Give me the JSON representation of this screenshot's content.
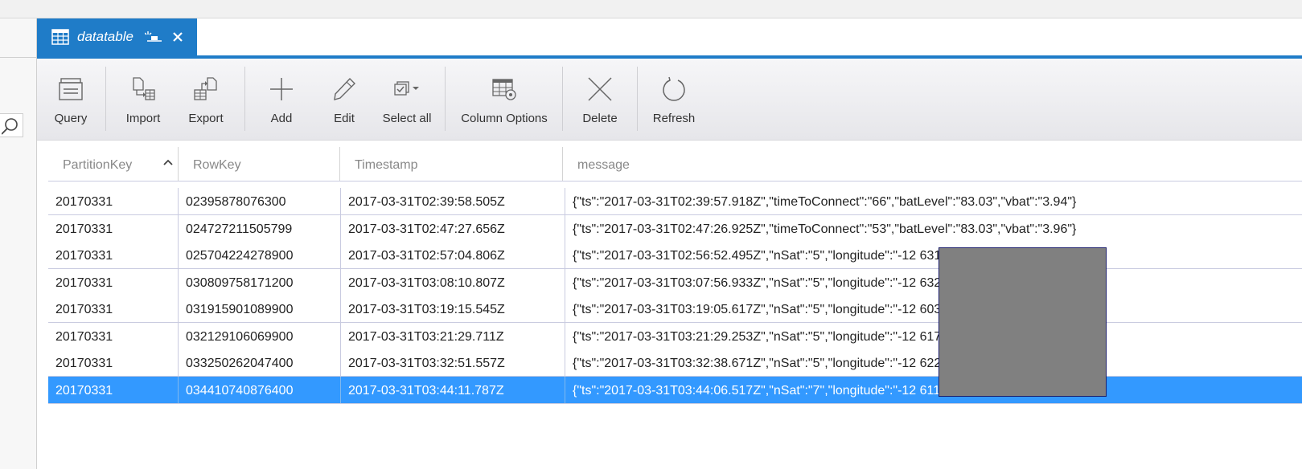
{
  "tab": {
    "title": "datatable",
    "icons": [
      "table-grid-icon",
      "pin-icon",
      "close-icon"
    ]
  },
  "toolbar": {
    "buttons": [
      {
        "label": "Query",
        "icon": "query-icon"
      },
      {
        "label": "Import",
        "icon": "import-icon"
      },
      {
        "label": "Export",
        "icon": "export-icon"
      },
      {
        "label": "Add",
        "icon": "plus-icon"
      },
      {
        "label": "Edit",
        "icon": "pencil-icon"
      },
      {
        "label": "Select all",
        "icon": "select-all-icon"
      },
      {
        "label": "Column Options",
        "icon": "column-options-icon"
      },
      {
        "label": "Delete",
        "icon": "x-icon"
      },
      {
        "label": "Refresh",
        "icon": "refresh-icon"
      }
    ]
  },
  "table": {
    "columns": [
      "PartitionKey",
      "RowKey",
      "Timestamp",
      "message"
    ],
    "sort": {
      "column": "PartitionKey",
      "direction": "ascending"
    },
    "rows": [
      {
        "partition": "20170331",
        "rowkey": "02395878076300",
        "timestamp": "2017-03-31T02:39:58.505Z",
        "message": "{\"ts\":\"2017-03-31T02:39:57.918Z\",\"timeToConnect\":\"66\",\"batLevel\":\"83.03\",\"vbat\":\"3.94\"}"
      },
      {
        "partition": "20170331",
        "rowkey": "024727211505799",
        "timestamp": "2017-03-31T02:47:27.656Z",
        "message": "{\"ts\":\"2017-03-31T02:47:26.925Z\",\"timeToConnect\":\"53\",\"batLevel\":\"83.03\",\"vbat\":\"3.96\"}"
      },
      {
        "partition": "20170331",
        "rowkey": "025704224278900",
        "timestamp": "2017-03-31T02:57:04.806Z",
        "message": "{\"ts\":\"2017-03-31T02:56:52.495Z\",\"nSat\":\"5\",\"longitude\":\"-12                                        6319\",\"timeToConnect\":\"5"
      },
      {
        "partition": "20170331",
        "rowkey": "030809758171200",
        "timestamp": "2017-03-31T03:08:10.807Z",
        "message": "{\"ts\":\"2017-03-31T03:07:56.933Z\",\"nSat\":\"5\",\"longitude\":\"-12                                        6327\",\"timeToConnect\":\"5"
      },
      {
        "partition": "20170331",
        "rowkey": "031915901089900",
        "timestamp": "2017-03-31T03:19:15.545Z",
        "message": "{\"ts\":\"2017-03-31T03:19:05.617Z\",\"nSat\":\"5\",\"longitude\":\"-12                                        6033\",\"timeToConnect\":\"5"
      },
      {
        "partition": "20170331",
        "rowkey": "032129106069900",
        "timestamp": "2017-03-31T03:21:29.711Z",
        "message": "{\"ts\":\"2017-03-31T03:21:29.253Z\",\"nSat\":\"5\",\"longitude\":\"-12                                         617\",\"timeToConnect\":\"59"
      },
      {
        "partition": "20170331",
        "rowkey": "033250262047400",
        "timestamp": "2017-03-31T03:32:51.557Z",
        "message": "{\"ts\":\"2017-03-31T03:32:38.671Z\",\"nSat\":\"5\",\"longitude\":\"-12                                        6228\",\"timeToConnect\":\"5"
      },
      {
        "partition": "20170331",
        "rowkey": "034410740876400",
        "timestamp": "2017-03-31T03:44:11.787Z",
        "message": "{\"ts\":\"2017-03-31T03:44:06.517Z\",\"nSat\":\"7\",\"longitude\":\"-12                                        6113\",\"timeToConnect\":\"7",
        "selected": true
      }
    ]
  },
  "colors": {
    "accent": "#1f7cc8",
    "selection": "#3399ff",
    "redaction": "#808080"
  }
}
